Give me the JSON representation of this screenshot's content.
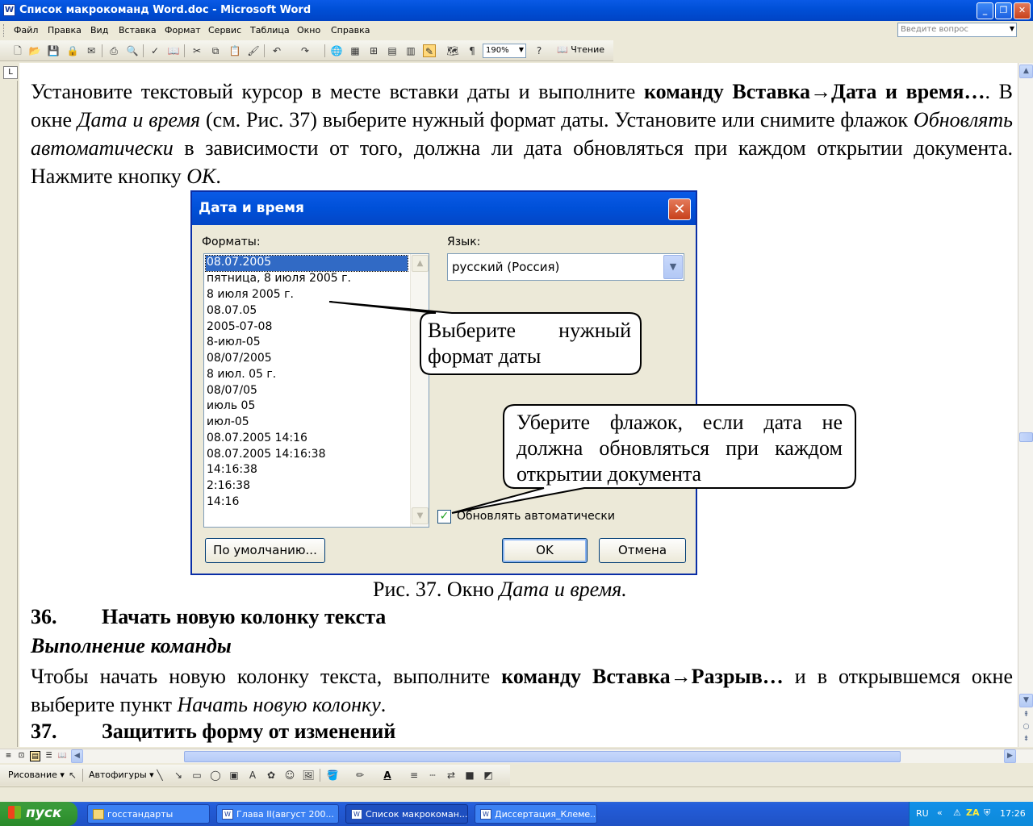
{
  "window": {
    "title": "Список макрокоманд Word.doc - Microsoft Word",
    "app_icon": "W",
    "caption_buttons": [
      "_",
      "❐",
      "✕"
    ]
  },
  "menu": {
    "items": [
      "Файл",
      "Правка",
      "Вид",
      "Вставка",
      "Формат",
      "Сервис",
      "Таблица",
      "Окно",
      "Справка"
    ],
    "help_placeholder": "Введите вопрос"
  },
  "toolbar": {
    "zoom": "190%",
    "reading_label": "Чтение"
  },
  "ruler": {
    "corner": "L"
  },
  "document": {
    "para1": {
      "t1": "Установите текстовый курсор в месте вставки даты и выполните ",
      "b1": "команду Вставка→Дата и время…",
      "t2": ". В окне ",
      "i1": "Дата и время",
      "t3": " (см. Рис. 37) выберите нужный формат даты. Установите или снимите флажок ",
      "i2": "Обновлять автоматически",
      "t4": " в зависимости от того, должна ли дата обновляться при каждом открытии документа. Нажмите кнопку ",
      "i3": "OK",
      "t5": "."
    },
    "caption": {
      "prefix": "Рис. 37. Окно ",
      "italic": "Дата и время."
    },
    "heading36": {
      "num": "36.",
      "text": "Начать новую колонку текста"
    },
    "subheading": "Выполнение команды",
    "para2": {
      "t1": "Чтобы начать новую колонку текста, выполните ",
      "b1": "команду Вставка→Разрыв…",
      "t2": " и в открывшемся окне выберите пункт ",
      "i1": "Начать новую колонку",
      "t3": "."
    },
    "heading37": {
      "num": "37.",
      "text": "Защитить форму от изменений"
    }
  },
  "dialog": {
    "title": "Дата и время",
    "formats_label": "Форматы:",
    "language_label": "Язык:",
    "language_value": "русский (Россия)",
    "formats": [
      "08.07.2005",
      "пятница, 8 июля 2005 г.",
      "8 июля 2005 г.",
      "08.07.05",
      "2005-07-08",
      "8-июл-05",
      "08/07/2005",
      "8 июл. 05 г.",
      "08/07/05",
      "июль 05",
      "июл-05",
      "08.07.2005 14:16",
      "08.07.2005 14:16:38",
      "14:16:38",
      "2:16:38",
      "14:16"
    ],
    "selected_index": 0,
    "auto_update_label": "Обновлять автоматически",
    "auto_update_checked": true,
    "default_button": "По умолчанию...",
    "ok_button": "OK",
    "cancel_button": "Отмена"
  },
  "callouts": {
    "format": "Выберите нужный формат даты",
    "checkbox": "Уберите флажок, если дата не должна обновляться при каждом открытии документа"
  },
  "drawing_toolbar": {
    "draw_label": "Рисование",
    "autoshapes_label": "Автофигуры"
  },
  "taskbar": {
    "start_label": "пуск",
    "tasks": [
      "госстандарты",
      "Глава II(август 200...",
      "Список макрокоман...",
      "Диссертация_Клеме..."
    ],
    "active_task_index": 2,
    "lang": "RU",
    "clock": "17:26"
  },
  "colors": {
    "titlebar": "#0050d8",
    "selection": "#316ac5",
    "taskbar": "#245edb",
    "start": "#379a37"
  }
}
